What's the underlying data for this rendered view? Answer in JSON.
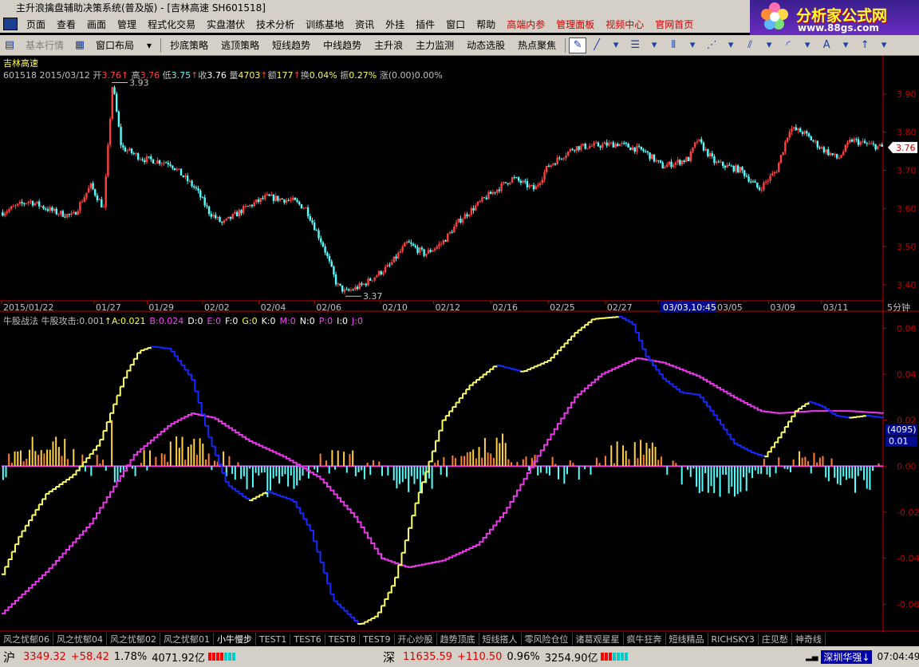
{
  "window": {
    "title": "主升浪擒盘辅助决策系统(普及版) - [吉林高速 SH601518]"
  },
  "menu": {
    "items": [
      "页面",
      "查看",
      "画面",
      "管理",
      "程式化交易",
      "实盘潜伏",
      "技术分析",
      "训练基地",
      "资讯",
      "外挂",
      "插件",
      "窗口",
      "帮助"
    ],
    "red_items": [
      "高端内参",
      "管理面板",
      "视频中心",
      "官网首页"
    ]
  },
  "brand": {
    "name": "分析家公式网",
    "url": "www.88gs.com"
  },
  "toolbar": {
    "basic_quote": "基本行情",
    "window_layout": "窗口布局",
    "strategies": [
      "抄底策略",
      "逃顶策略",
      "短线趋势",
      "中线趋势",
      "主升浪",
      "主力监测",
      "动态选股",
      "热点聚焦"
    ]
  },
  "stock": {
    "name": "吉林高速",
    "code": "601518",
    "date": "2015/03/12",
    "open_label": "开",
    "open": "3.76",
    "high_label": "高",
    "high": "3.76",
    "low_label": "低",
    "low": "3.75",
    "close_label": "收",
    "close": "3.76",
    "volume_label": "量",
    "volume": "4703",
    "amount_label": "额",
    "amount": "177",
    "turnover_label": "换",
    "turnover": "0.04%",
    "amplitude_label": "振",
    "amplitude": "0.27%",
    "change_label": "涨",
    "change": "(0.00)0.00%",
    "price_max_label": "3.93",
    "price_min_label": "3.37",
    "current_price": "3.76",
    "period": "5分钟",
    "cursor_time": "03/03,10:45"
  },
  "indicator": {
    "name": "牛股战法",
    "main_label": "牛股攻击",
    "main_value": "0.001",
    "items": [
      {
        "k": "A",
        "v": "0.021",
        "color": "#ffff40"
      },
      {
        "k": "B",
        "v": "0.024",
        "color": "#ff40ff"
      },
      {
        "k": "D",
        "v": "0",
        "color": "#ffffff"
      },
      {
        "k": "E",
        "v": "0",
        "color": "#ff40ff"
      },
      {
        "k": "F",
        "v": "0",
        "color": "#ffffff"
      },
      {
        "k": "G",
        "v": "0",
        "color": "#ffff40"
      },
      {
        "k": "K",
        "v": "0",
        "color": "#ffffff"
      },
      {
        "k": "M",
        "v": "0",
        "color": "#ff40ff"
      },
      {
        "k": "N",
        "v": "0",
        "color": "#ffffff"
      },
      {
        "k": "P",
        "v": "0",
        "color": "#ff40ff"
      },
      {
        "k": "I",
        "v": "0",
        "color": "#ffffff"
      },
      {
        "k": "J",
        "v": "0",
        "color": "#ff40ff"
      }
    ],
    "cursor_badge": "(4095)",
    "cursor_value": "0.01"
  },
  "chart_data": [
    {
      "type": "candlestick",
      "title": "吉林高速",
      "x_ticks": [
        "2015/01/22",
        "01/27",
        "01/29",
        "02/02",
        "02/04",
        "02/06",
        "02/10",
        "02/12",
        "02/16",
        "02/25",
        "02/27",
        "03/03",
        "03/05",
        "03/09",
        "03/11"
      ],
      "y_ticks": [
        "3.90",
        "3.80",
        "3.70",
        "3.60",
        "3.50",
        "3.40"
      ],
      "ylim": [
        3.36,
        3.95
      ],
      "close_path": [
        [
          0,
          3.59
        ],
        [
          0.03,
          3.62
        ],
        [
          0.06,
          3.59
        ],
        [
          0.08,
          3.58
        ],
        [
          0.1,
          3.66
        ],
        [
          0.115,
          3.6
        ],
        [
          0.125,
          3.93
        ],
        [
          0.135,
          3.76
        ],
        [
          0.16,
          3.73
        ],
        [
          0.19,
          3.72
        ],
        [
          0.22,
          3.65
        ],
        [
          0.235,
          3.59
        ],
        [
          0.25,
          3.56
        ],
        [
          0.275,
          3.6
        ],
        [
          0.3,
          3.63
        ],
        [
          0.33,
          3.62
        ],
        [
          0.345,
          3.6
        ],
        [
          0.365,
          3.5
        ],
        [
          0.38,
          3.4
        ],
        [
          0.39,
          3.38
        ],
        [
          0.41,
          3.4
        ],
        [
          0.44,
          3.45
        ],
        [
          0.46,
          3.51
        ],
        [
          0.48,
          3.48
        ],
        [
          0.5,
          3.51
        ],
        [
          0.52,
          3.57
        ],
        [
          0.55,
          3.63
        ],
        [
          0.58,
          3.68
        ],
        [
          0.605,
          3.65
        ],
        [
          0.62,
          3.71
        ],
        [
          0.65,
          3.76
        ],
        [
          0.7,
          3.77
        ],
        [
          0.73,
          3.75
        ],
        [
          0.75,
          3.71
        ],
        [
          0.78,
          3.73
        ],
        [
          0.79,
          3.78
        ],
        [
          0.81,
          3.72
        ],
        [
          0.84,
          3.7
        ],
        [
          0.86,
          3.65
        ],
        [
          0.88,
          3.7
        ],
        [
          0.895,
          3.81
        ],
        [
          0.91,
          3.8
        ],
        [
          0.93,
          3.76
        ],
        [
          0.95,
          3.73
        ],
        [
          0.965,
          3.78
        ],
        [
          0.98,
          3.77
        ],
        [
          1.0,
          3.76
        ]
      ]
    },
    {
      "type": "line",
      "title": "牛股战法",
      "y_ticks": [
        "0.06",
        "0.04",
        "0.02",
        "0.00",
        "-0.02",
        "-0.04",
        "-0.06"
      ],
      "ylim": [
        -0.071,
        0.066
      ],
      "series": [
        {
          "name": "牛股攻击",
          "color_up": "#ffff66",
          "color_down": "#1428ff",
          "points": [
            [
              0,
              -0.047
            ],
            [
              0.02,
              -0.03
            ],
            [
              0.05,
              -0.012
            ],
            [
              0.08,
              -0.004
            ],
            [
              0.11,
              0.01
            ],
            [
              0.14,
              0.04
            ],
            [
              0.155,
              0.05
            ],
            [
              0.17,
              0.052
            ],
            [
              0.19,
              0.051
            ],
            [
              0.215,
              0.038
            ],
            [
              0.235,
              0.012
            ],
            [
              0.255,
              -0.008
            ],
            [
              0.28,
              -0.015
            ],
            [
              0.3,
              -0.011
            ],
            [
              0.33,
              -0.015
            ],
            [
              0.35,
              -0.028
            ],
            [
              0.375,
              -0.058
            ],
            [
              0.405,
              -0.069
            ],
            [
              0.425,
              -0.065
            ],
            [
              0.445,
              -0.05
            ],
            [
              0.47,
              -0.015
            ],
            [
              0.5,
              0.02
            ],
            [
              0.53,
              0.035
            ],
            [
              0.56,
              0.044
            ],
            [
              0.59,
              0.041
            ],
            [
              0.62,
              0.046
            ],
            [
              0.65,
              0.058
            ],
            [
              0.67,
              0.064
            ],
            [
              0.7,
              0.065
            ],
            [
              0.715,
              0.062
            ],
            [
              0.73,
              0.048
            ],
            [
              0.75,
              0.038
            ],
            [
              0.77,
              0.032
            ],
            [
              0.79,
              0.031
            ],
            [
              0.81,
              0.021
            ],
            [
              0.83,
              0.01
            ],
            [
              0.85,
              0.006
            ],
            [
              0.865,
              0.004
            ],
            [
              0.88,
              0.012
            ],
            [
              0.9,
              0.024
            ],
            [
              0.915,
              0.028
            ],
            [
              0.93,
              0.026
            ],
            [
              0.945,
              0.022
            ],
            [
              0.96,
              0.021
            ],
            [
              0.98,
              0.022
            ],
            [
              1.0,
              0.021
            ]
          ]
        },
        {
          "name": "A",
          "color": "#e838e8",
          "points": [
            [
              0,
              -0.064
            ],
            [
              0.05,
              -0.046
            ],
            [
              0.1,
              -0.025
            ],
            [
              0.15,
              0.005
            ],
            [
              0.19,
              0.018
            ],
            [
              0.215,
              0.023
            ],
            [
              0.24,
              0.021
            ],
            [
              0.28,
              0.011
            ],
            [
              0.32,
              0.004
            ],
            [
              0.36,
              -0.005
            ],
            [
              0.4,
              -0.022
            ],
            [
              0.43,
              -0.04
            ],
            [
              0.46,
              -0.044
            ],
            [
              0.5,
              -0.041
            ],
            [
              0.54,
              -0.034
            ],
            [
              0.57,
              -0.02
            ],
            [
              0.61,
              0.006
            ],
            [
              0.65,
              0.03
            ],
            [
              0.68,
              0.04
            ],
            [
              0.72,
              0.047
            ],
            [
              0.75,
              0.045
            ],
            [
              0.79,
              0.039
            ],
            [
              0.83,
              0.03
            ],
            [
              0.86,
              0.024
            ],
            [
              0.88,
              0.023
            ],
            [
              0.92,
              0.024
            ],
            [
              0.96,
              0.024
            ],
            [
              1.0,
              0.023
            ]
          ]
        }
      ]
    }
  ],
  "bottom_tabs": [
    "风之忧郁06",
    "风之忧郁04",
    "风之忧郁02",
    "风之忧郁01",
    "小牛慢步",
    "TEST1",
    "TEST6",
    "TEST8",
    "TEST9",
    "开心炒股",
    "趋势顶底",
    "短线搭人",
    "零风险仓位",
    "诸葛观星星",
    "疯牛狂奔",
    "短线精品",
    "RICHSKY3",
    "庄见愁",
    "神奇线"
  ],
  "status": {
    "sh_label": "沪",
    "sh_index": "3349.32",
    "sh_change": "+58.42",
    "sh_pct": "1.78%",
    "sh_amount": "4071.92亿",
    "sz_label": "深",
    "sz_index": "11635.59",
    "sz_change": "+110.50",
    "sz_pct": "0.96%",
    "sz_amount": "3254.90亿",
    "stock_tip": "深圳华强↓",
    "time": "07:04:49"
  },
  "colors": {
    "up": "#ff4040",
    "down": "#54ffff",
    "axis": "#c00000",
    "text": "#c0c0c0"
  }
}
